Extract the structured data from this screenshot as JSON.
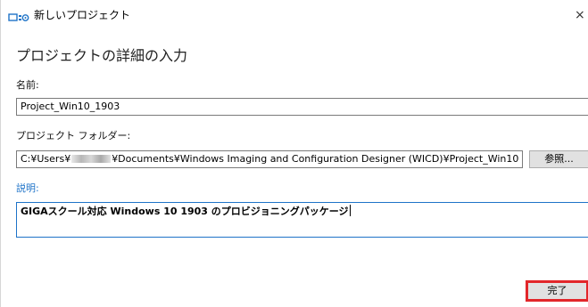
{
  "window": {
    "title": "新しいプロジェクト",
    "close_glyph": "×"
  },
  "heading": "プロジェクトの詳細の入力",
  "fields": {
    "name_label": "名前:",
    "name_value": "Project_Win10_1903",
    "folder_label": "プロジェクト フォルダー:",
    "folder_value_prefix": "C:¥Users¥",
    "folder_value_suffix": "¥Documents¥Windows Imaging and Configuration Designer (WICD)¥Project_Win10",
    "description_label": "説明:",
    "description_value": "GIGAスクール対応 Windows 10 1903 のプロビジョニングパッケージ"
  },
  "buttons": {
    "browse_label": "参照...",
    "finish_label": "完了"
  },
  "colors": {
    "accent": "#1e73c8",
    "highlight": "#e2262a"
  },
  "icons": {
    "app": "wicd-app-icon"
  }
}
